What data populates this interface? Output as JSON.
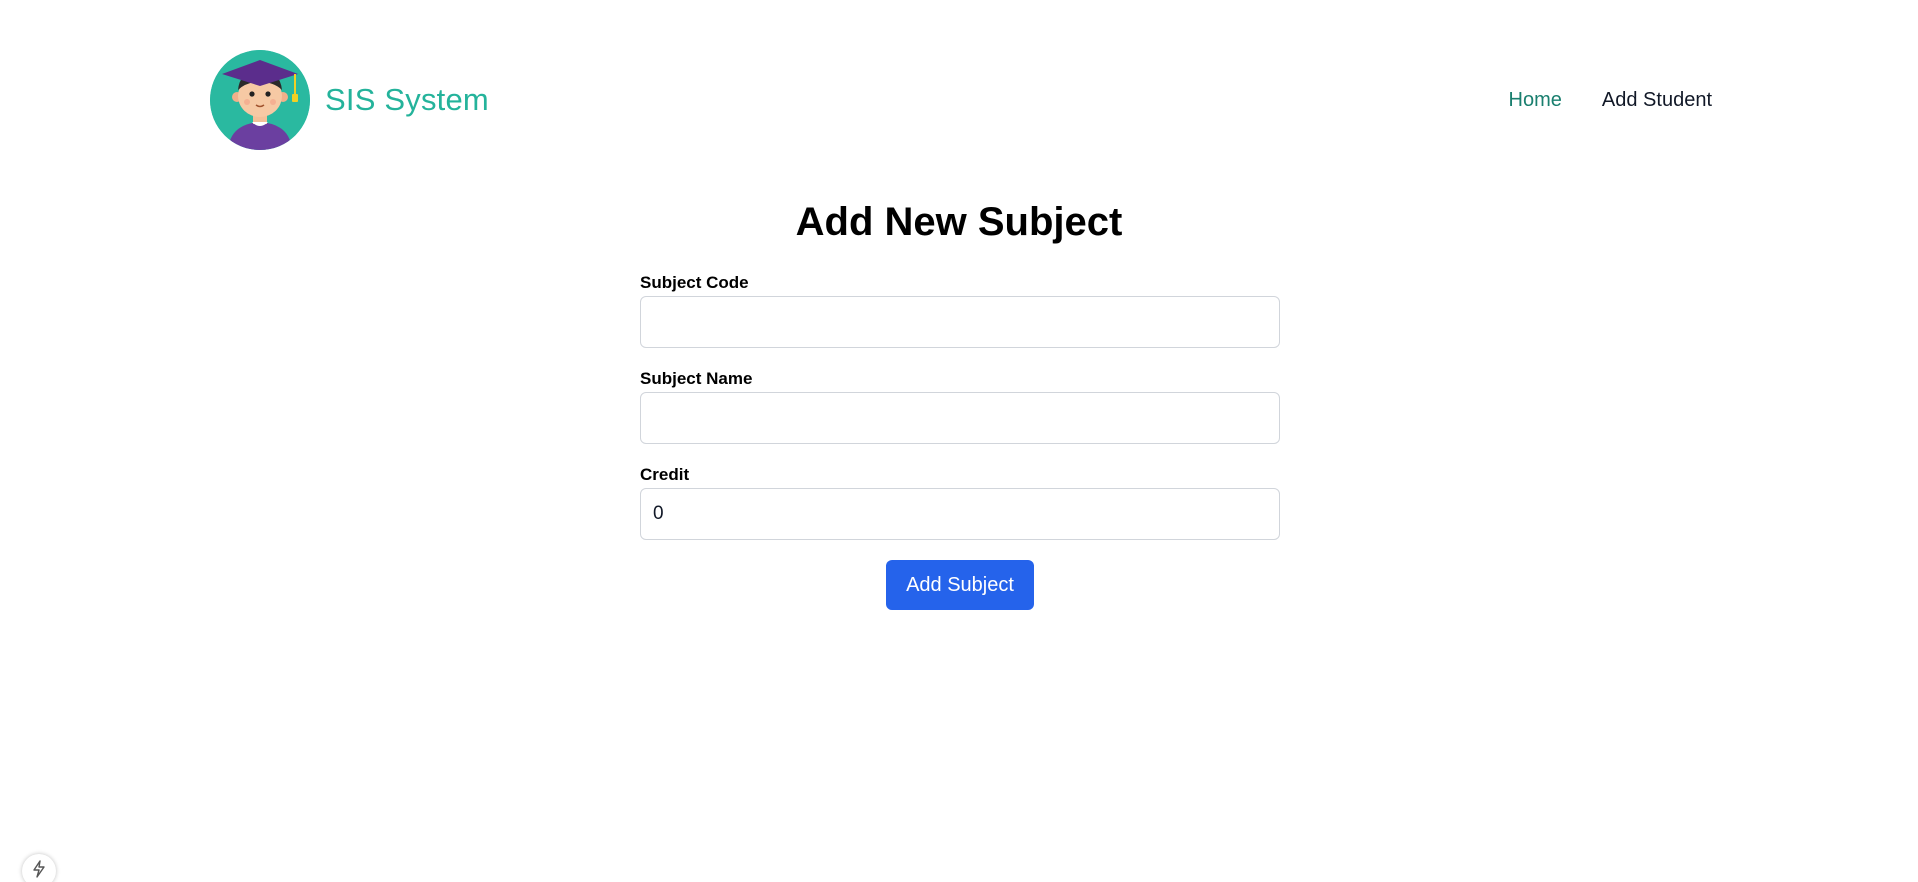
{
  "header": {
    "brand_name": "SIS System",
    "logo_icon": "graduate-avatar-icon",
    "nav": [
      {
        "label": "Home",
        "active": true
      },
      {
        "label": "Add Student",
        "active": false
      }
    ]
  },
  "form": {
    "title": "Add New Subject",
    "fields": [
      {
        "label": "Subject Code",
        "value": "",
        "placeholder": ""
      },
      {
        "label": "Subject Name",
        "value": "",
        "placeholder": ""
      },
      {
        "label": "Credit",
        "value": "0",
        "placeholder": ""
      }
    ],
    "submit_label": "Add Subject"
  },
  "corner_icon": "lightning-icon",
  "colors": {
    "brand": "#24b39b",
    "nav_active": "#1a7f6f",
    "button": "#2563eb",
    "logo_bg": "#2ab9a0"
  }
}
